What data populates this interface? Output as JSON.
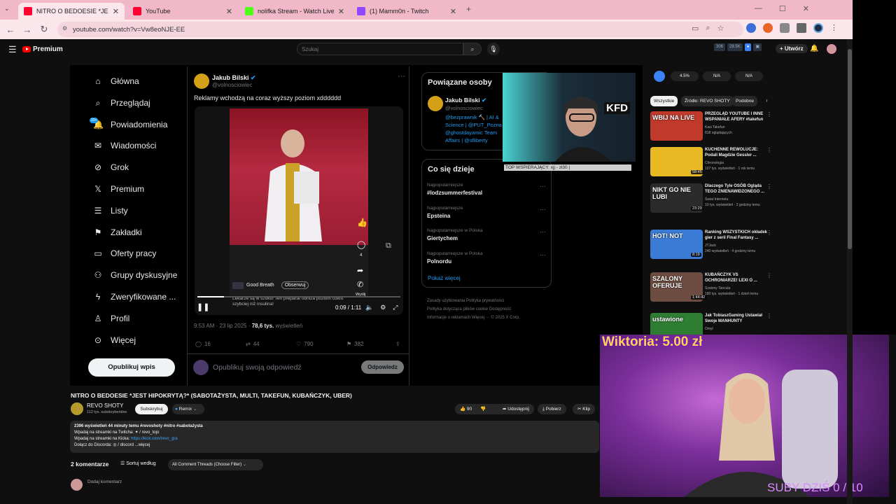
{
  "browser": {
    "tabs": [
      {
        "title": "NITRO O BEDOESIE *JEST H",
        "color": "#ff0033"
      },
      {
        "title": "YouTube",
        "color": "#ff0033"
      },
      {
        "title": "nolifka Stream - Watch Live on",
        "color": "#53fc18"
      },
      {
        "title": "(1) Mamm0n - Twitch",
        "color": "#9146ff"
      }
    ],
    "new_tab": "+",
    "url": "youtube.com/watch?v=Vw8eoNJE-EE"
  },
  "yt_header": {
    "logo": "Premium",
    "search_placeholder": "Szukaj",
    "create_label": "Utwórz",
    "stats": [
      "306",
      "28.5K"
    ]
  },
  "x_sidebar": {
    "items": [
      {
        "label": "Główna",
        "icon": "home-icon",
        "glyph": "⌂"
      },
      {
        "label": "Przeglądaj",
        "icon": "search-icon",
        "glyph": "⌕"
      },
      {
        "label": "Powiadomienia",
        "icon": "bell-icon",
        "glyph": "🔔"
      },
      {
        "label": "Wiadomości",
        "icon": "mail-icon",
        "glyph": "✉"
      },
      {
        "label": "Grok",
        "icon": "grok-icon",
        "glyph": "⊘"
      },
      {
        "label": "Premium",
        "icon": "x-icon",
        "glyph": "𝕏"
      },
      {
        "label": "Listy",
        "icon": "list-icon",
        "glyph": "☰"
      },
      {
        "label": "Zakładki",
        "icon": "bookmark-icon",
        "glyph": "⚑"
      },
      {
        "label": "Oferty pracy",
        "icon": "briefcase-icon",
        "glyph": "▭"
      },
      {
        "label": "Grupy dyskusyjne",
        "icon": "groups-icon",
        "glyph": "⚇"
      },
      {
        "label": "Zweryfikowane ...",
        "icon": "lightning-icon",
        "glyph": "ϟ"
      },
      {
        "label": "Profil",
        "icon": "profile-icon",
        "glyph": "♙"
      },
      {
        "label": "Więcej",
        "icon": "more-icon",
        "glyph": "⊙"
      }
    ],
    "notif_badge": "20+",
    "publish": "Opublikuj wpis"
  },
  "tweet": {
    "name": "Jakub Bilski",
    "handle": "@volnosciowiec",
    "text": "Reklamy wchodzą na coraz wyższy poziom xdddddd",
    "ad_account": "Good Breath",
    "follow": "Obserwuj",
    "ad_caption": "Lekarze są w szoku! Ten preparat obniża poziom cukru szybciej niż insulina!",
    "send_label": "Wyślij",
    "likes_small": "4",
    "time": "0:09 / 1:11",
    "meta_time": "9:53 AM · 23 lip 2025 · ",
    "views": "78,6 tys.",
    "views_label": " wyświetleń",
    "replies": "16",
    "retweets": "44",
    "likes": "790",
    "bookmarks": "382",
    "reply_placeholder": "Opublikuj swoją odpowiedź",
    "reply_button": "Odpowiedz"
  },
  "related": {
    "title": "Powiązane osoby",
    "name": "Jakub Bilski",
    "handle": "@volnosciowiec",
    "bio1": "@bezprawnik 🔨 | AI &",
    "bio2": "Science | @PUT_Pozna",
    "bio3": "@ghostdayamic Team",
    "bio4": "Affairs | @sfliberty"
  },
  "happening": {
    "title": "Co się dzieje",
    "trends": [
      {
        "cat": "Najpopularniejsze",
        "name": "#lodzsummerfestival"
      },
      {
        "cat": "Najpopularniejsze",
        "name": "Epsteina"
      },
      {
        "cat": "Najpopularniejsze w Polska",
        "name": "Giertychem"
      },
      {
        "cat": "Najpopularniejsze w Polska",
        "name": "Polnordu"
      }
    ],
    "more": "Pokaż więcej"
  },
  "x_footer": {
    "line1": "Zasady użytkowania    Polityka prywatności",
    "line2": "Polityka dotycząca plików cookie    Dostępność",
    "line3": "Informacje o reklamach    Więcej ···    © 2025 X Corp."
  },
  "cam_top": {
    "banner": "TOP WSPIERAJĄCY: xjj - zł30 |",
    "logo": "KFD"
  },
  "video": {
    "title": "NITRO O BEDOESIE *JEST HIPOKRYTĄ?* (SABOTAŻYSTA, MULTI, TAKEFUN, KUBAŃCZYK, UBER)",
    "channel": "REVO SHOTY",
    "subs": "112 tys. subskrybentów",
    "subscribe": "Subskrybuj",
    "remix": "Remix",
    "likes": "90",
    "share": "Udostępnij",
    "download": "Pobierz",
    "clip": "Klip",
    "desc_line1": "2396 wyświetleń  44 minuty temu  #revoshoty #nitro #sabotażysta",
    "desc_line2": "Wpadaj na streamki na Twitcha: ✦ / revo_tojo",
    "desc_line3a": "Wpadaj na streamki na Kicka: ",
    "desc_link": "https://kick.com/revo_gra",
    "desc_line4": "Dołącz do Discorda: ◎ / discord   ...więcej",
    "comments": "2 komentarze",
    "sort": "Sortuj według",
    "filter": "All Comment Threads (Choose Filter)",
    "add_comment": "Dodaj komentarz"
  },
  "ext_panel": {
    "values": [
      "4.5%",
      "N/A",
      "N/A"
    ]
  },
  "chips": [
    "Wszystkie",
    "Źródło: REVO SHOTY",
    "Podobne"
  ],
  "recommendations": [
    {
      "title": "PRZEGLĄD YOUTUBE I INNE WSPANIAŁE AFERY #takefun",
      "channel": "Kasi Takefun",
      "meta": "818 oglądających",
      "dur": "",
      "thumb": "#c0392b",
      "overlay": "WBIJ NA LIVE"
    },
    {
      "title": "KUCHENNE REWOLUCJE: Podali Magdzie Gessler ...",
      "channel": "Chronologia",
      "meta": "107 tys. wyświetleń · 1 rok temu",
      "dur": "58:45",
      "thumb": "#e8b923",
      "overlay": ""
    },
    {
      "title": "Dlaczego Tyle OSÓB Ogląda TEGO ZNIENAWIDZONEGO ...",
      "channel": "Świat Internetu",
      "meta": "10 tys. wyświetleń · 2 godziny temu",
      "dur": "23:29",
      "thumb": "#2b2b2b",
      "overlay": "NIKT GO NIE LUBI"
    },
    {
      "title": "Ranking WSZYSTKICH okładek gier z serii Final Fantasy ...",
      "channel": "JTJack",
      "meta": "240 wyświetleń · 4 godziny temu",
      "dur": "8:19",
      "thumb": "#3a7bd5",
      "overlay": "HOT!  NOT"
    },
    {
      "title": "KUBAŃCZYK VS OCHRONIARZE! LEXI O ...",
      "channel": "Szalony Tancula",
      "meta": "180 tys. wyświetleń · 1 dzień temu",
      "dur": "1:44:42",
      "thumb": "#6d4c41",
      "overlay": "SZALONY OFERUJE"
    },
    {
      "title": "Jak TobiaszGaming Ustawiał Swoje MANHUNTY",
      "channel": "Omyl",
      "meta": "",
      "dur": "",
      "thumb": "#2e7d32",
      "overlay": "ustawione"
    }
  ],
  "cam_bottom": {
    "donation": "Wiktoria: 5.00 zł",
    "subs_counter": "SUBY DZIŚ  0 / 10"
  }
}
